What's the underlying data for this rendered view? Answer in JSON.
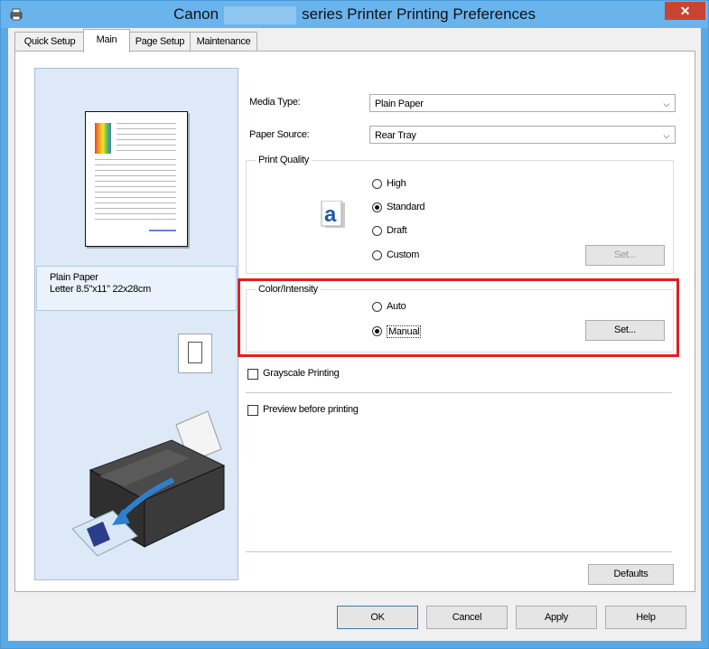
{
  "window": {
    "title_prefix": "Canon",
    "title_suffix": "series Printer Printing Preferences",
    "close_glyph": "✕",
    "accent_color": "#6ab4ee",
    "close_color": "#c84431"
  },
  "tabs": [
    {
      "label": "Quick Setup",
      "active": false
    },
    {
      "label": "Main",
      "active": true
    },
    {
      "label": "Page Setup",
      "active": false
    },
    {
      "label": "Maintenance",
      "active": false
    }
  ],
  "preview": {
    "paper_line1": "Plain Paper",
    "paper_line2": "Letter 8.5\"x11\" 22x28cm"
  },
  "media_type": {
    "label": "Media Type:",
    "value": "Plain Paper"
  },
  "paper_source": {
    "label": "Paper Source:",
    "value": "Rear Tray"
  },
  "print_quality": {
    "label": "Print Quality",
    "options": [
      "High",
      "Standard",
      "Draft",
      "Custom"
    ],
    "selected": "Standard",
    "set_button": "Set...",
    "set_enabled": false
  },
  "color_intensity": {
    "label": "Color/Intensity",
    "options": [
      "Auto",
      "Manual"
    ],
    "selected": "Manual",
    "set_button": "Set...",
    "highlight_color": "#e02020"
  },
  "grayscale": {
    "label": "Grayscale Printing",
    "checked": false
  },
  "preview_before": {
    "label": "Preview before printing",
    "checked": false
  },
  "defaults_button": "Defaults",
  "footer": {
    "ok": "OK",
    "cancel": "Cancel",
    "apply": "Apply",
    "help": "Help"
  },
  "icons": {
    "title_icon": "printer-icon",
    "quality_icon": "letter-a-icon",
    "orientation_icon": "portrait-page-icon",
    "illustration": "printer-paper-feed-illustration"
  }
}
